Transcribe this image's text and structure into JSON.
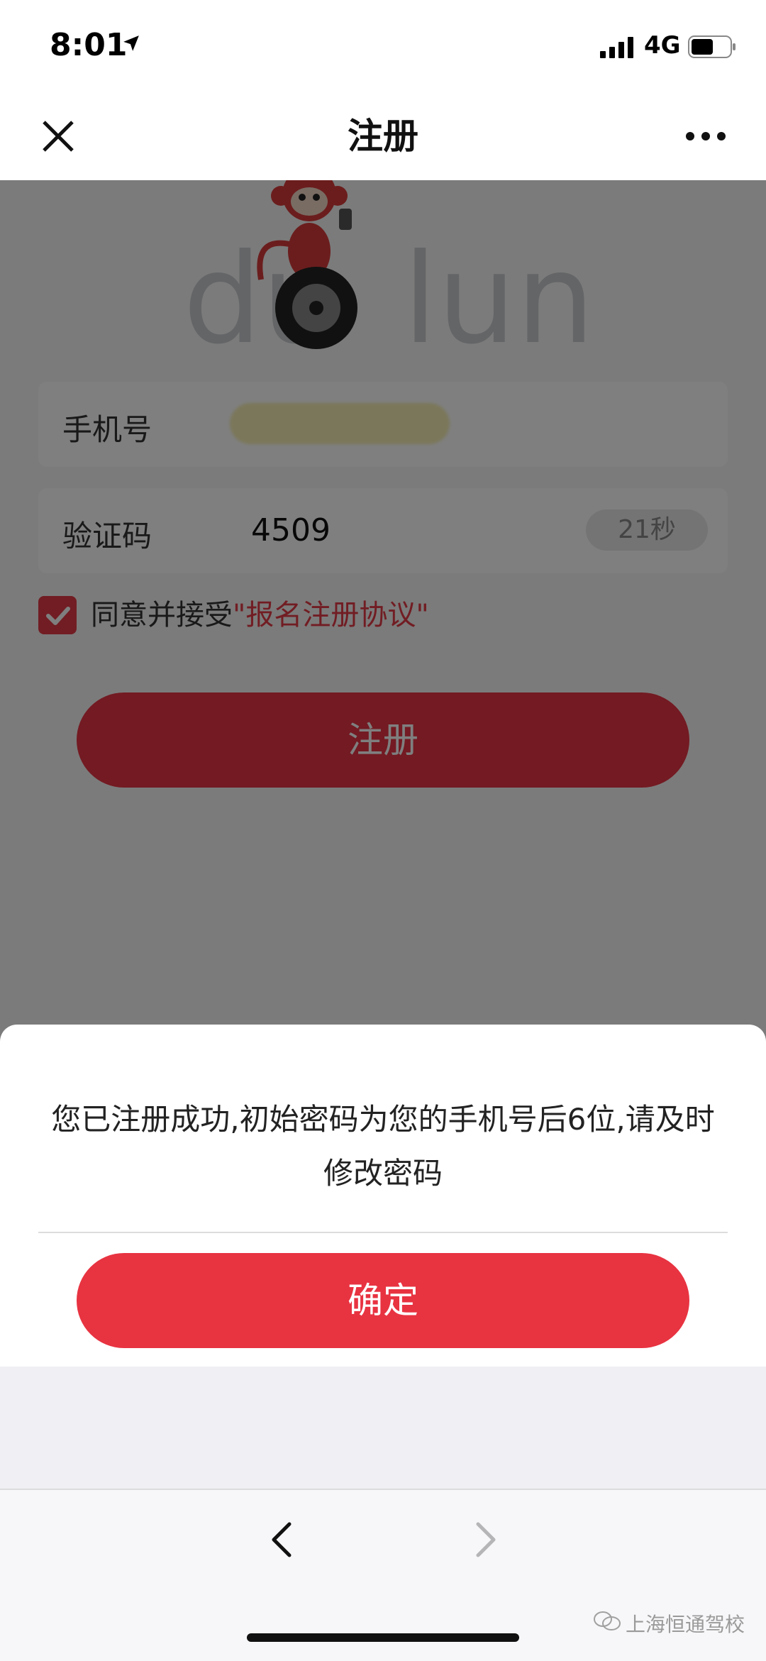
{
  "status_bar": {
    "time": "8:01",
    "network": "4G"
  },
  "nav": {
    "title": "注册"
  },
  "logo": {
    "text": "duolun"
  },
  "form": {
    "phone_label": "手机号",
    "code_label": "验证码",
    "code_value": "4509",
    "countdown": "21秒",
    "agree_text": "同意并接受",
    "agree_link": "\"报名注册协议\""
  },
  "register_button": "注册",
  "dialog": {
    "message": "您已注册成功,初始密码为您的手机号后6位,请及时修改密码",
    "confirm": "确定"
  },
  "watermark": "上海恒通驾校",
  "colors": {
    "accent": "#e83341",
    "overlay": "rgba(0,0,0,0.5)"
  }
}
